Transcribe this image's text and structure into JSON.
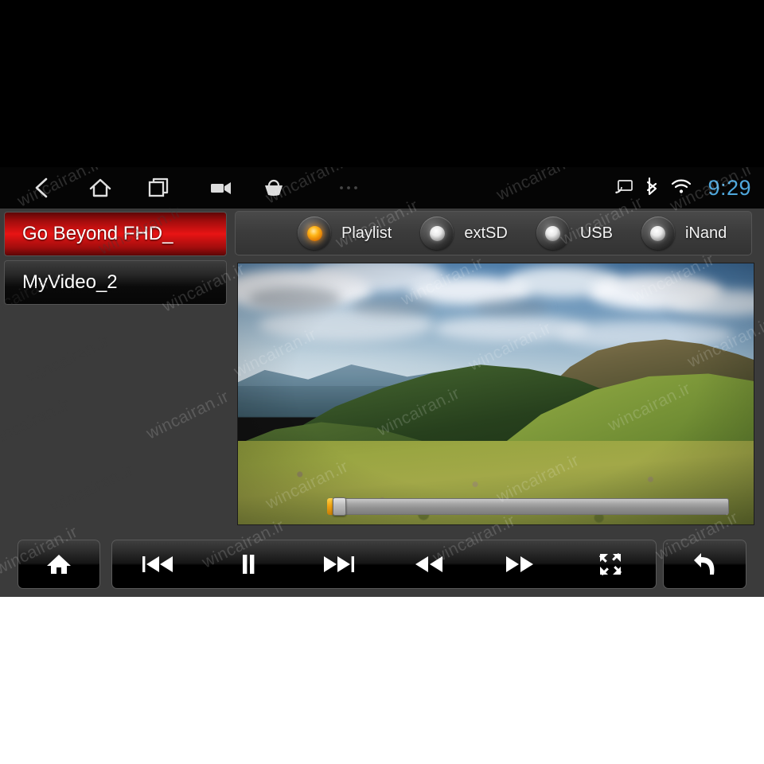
{
  "device": {
    "name": "car-head-unit-video-player"
  },
  "navbar": {
    "items": [
      {
        "label": "Back",
        "icon": "chevron-left-icon"
      },
      {
        "label": "Home",
        "icon": "home-outline-icon"
      },
      {
        "label": "Recent apps",
        "icon": "recent-apps-icon"
      },
      {
        "label": "Camera",
        "icon": "video-camera-icon"
      },
      {
        "label": "Apps",
        "icon": "basket-icon"
      },
      {
        "label": "More",
        "icon": "overflow-dots-icon"
      }
    ]
  },
  "statusbar": {
    "cast_icon": "cast-icon",
    "bluetooth_icon": "bluetooth-icon",
    "wifi_icon": "wifi-icon",
    "clock": "9:29",
    "clock_color": "#4fa8dd"
  },
  "playlist": {
    "items": [
      {
        "title": "Go Beyond FHD_",
        "selected": true
      },
      {
        "title": "MyVideo_2",
        "selected": false
      }
    ],
    "selected_color": "#e81414"
  },
  "sources": {
    "options": [
      {
        "label": "Playlist",
        "active": true
      },
      {
        "label": "extSD",
        "active": false
      },
      {
        "label": "USB",
        "active": false
      },
      {
        "label": "iNand",
        "active": false
      }
    ],
    "active_led_color": "#ffb517",
    "idle_led_color": "#e9e9e9"
  },
  "video": {
    "scene": "mountain-landscape-alpine-meadow",
    "progress_percent": 1,
    "seek_handle_color": "#f0a313"
  },
  "controls": {
    "home": {
      "label": "Home",
      "icon": "home-filled-icon"
    },
    "transport": [
      {
        "label": "Previous",
        "icon": "previous-track-icon"
      },
      {
        "label": "Pause",
        "icon": "pause-icon"
      },
      {
        "label": "Next",
        "icon": "next-track-icon"
      },
      {
        "label": "Rewind",
        "icon": "rewind-icon"
      },
      {
        "label": "Fast forward",
        "icon": "fast-forward-icon"
      },
      {
        "label": "Fullscreen",
        "icon": "fullscreen-icon"
      }
    ],
    "back": {
      "label": "Back",
      "icon": "return-arrow-icon"
    }
  },
  "watermark": {
    "text": "wincairan.ir"
  }
}
